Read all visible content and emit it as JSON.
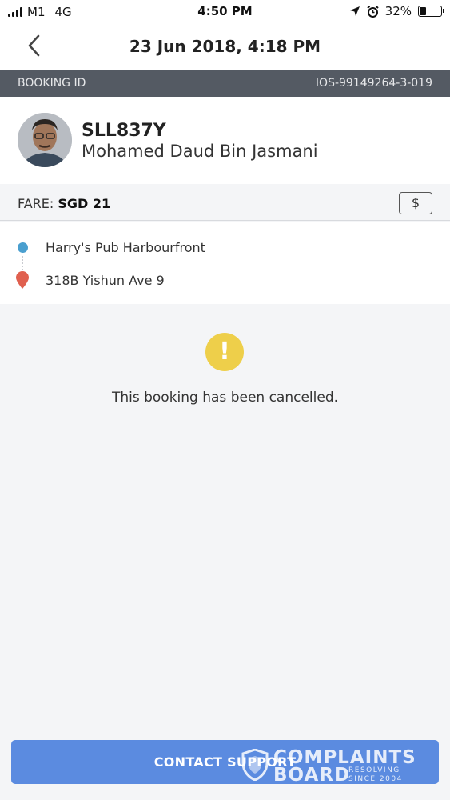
{
  "status_bar": {
    "carrier": "M1",
    "network": "4G",
    "time": "4:50 PM",
    "battery": "32%",
    "battery_level": 0.32,
    "icons": [
      "signal-icon",
      "location-arrow-icon",
      "alarm-icon",
      "battery-icon"
    ]
  },
  "nav": {
    "title": "23 Jun 2018, 4:18 PM",
    "back_icon": "chevron-left-icon"
  },
  "booking": {
    "label": "BOOKING ID",
    "id": "IOS-99149264-3-019"
  },
  "driver": {
    "plate": "SLL837Y",
    "name": "Mohamed Daud Bin Jasmani"
  },
  "fare": {
    "label": "FARE: ",
    "amount": "SGD 21",
    "button_symbol": "$"
  },
  "route": {
    "pickup": "Harry's Pub Harbourfront",
    "dropoff": "318B Yishun Ave 9"
  },
  "status": {
    "icon": "!",
    "message": "This booking has been cancelled."
  },
  "footer": {
    "support_label": "CONTACT SUPPORT"
  },
  "watermark": {
    "line1": "COMPLAINTS",
    "line2": "BOARD",
    "sub1": "RESOLVING",
    "sub2": "SINCE 2004"
  },
  "colors": {
    "header_bar": "#545a63",
    "accent_button": "#5b8be0",
    "pickup_dot": "#4a9fcf",
    "dropoff_pin": "#e0604f",
    "warning": "#eecf4a"
  }
}
